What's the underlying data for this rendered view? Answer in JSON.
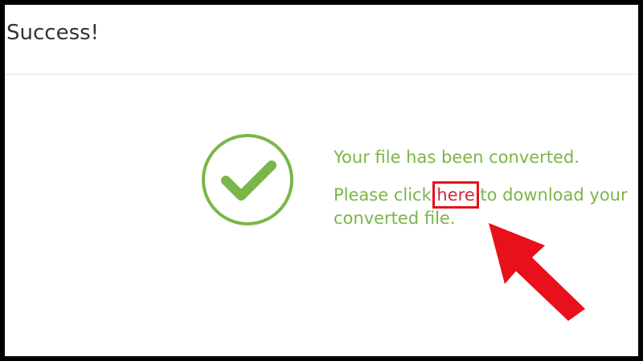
{
  "header": {
    "title": "Success!"
  },
  "status": {
    "icon": "checkmark-circle-icon",
    "color": "#7ab648"
  },
  "message": {
    "converted_text": "Your file has been converted.",
    "prefix_text": "Please click ",
    "link_text": "here",
    "suffix_text": " to download your converted file.",
    "link_color": "#cf2b3b"
  },
  "annotation": {
    "icon": "red-arrow-icon",
    "highlight_color": "#e8101a"
  }
}
